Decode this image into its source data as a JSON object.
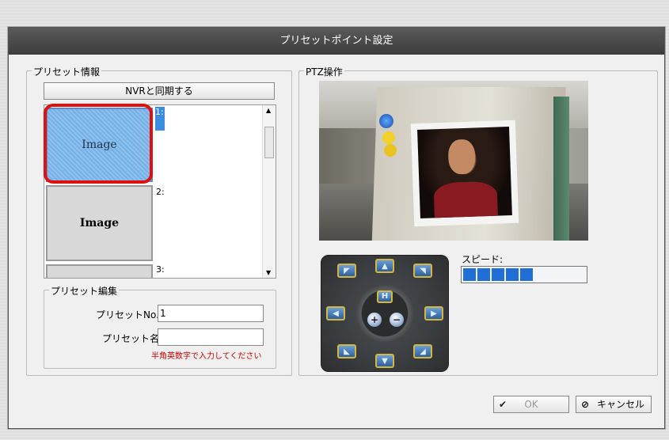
{
  "dialog": {
    "title": "プリセットポイント設定"
  },
  "preset_info": {
    "group_label": "プリセット情報",
    "sync_button": "NVRと同期する",
    "items": [
      {
        "number": "1:",
        "thumb_text": "Image",
        "selected": true
      },
      {
        "number": "2:",
        "thumb_text": "Image",
        "selected": false
      },
      {
        "number": "3:",
        "thumb_text": "",
        "selected": false
      }
    ]
  },
  "preset_edit": {
    "group_label": "プリセット編集",
    "no_label": "プリセットNo.",
    "no_value": "1",
    "name_label": "プリセット名",
    "name_value": "",
    "hint": "半角英数字で入力してください"
  },
  "ptz": {
    "group_label": "PTZ操作",
    "speed_label": "スピード:",
    "speed_level": 5,
    "home_label": "H"
  },
  "footer": {
    "ok_label": "OK",
    "cancel_label": "キャンセル"
  },
  "colors": {
    "accent": "#1f6fd6",
    "highlight_ring": "#e01010",
    "hint_text": "#cc0000"
  }
}
